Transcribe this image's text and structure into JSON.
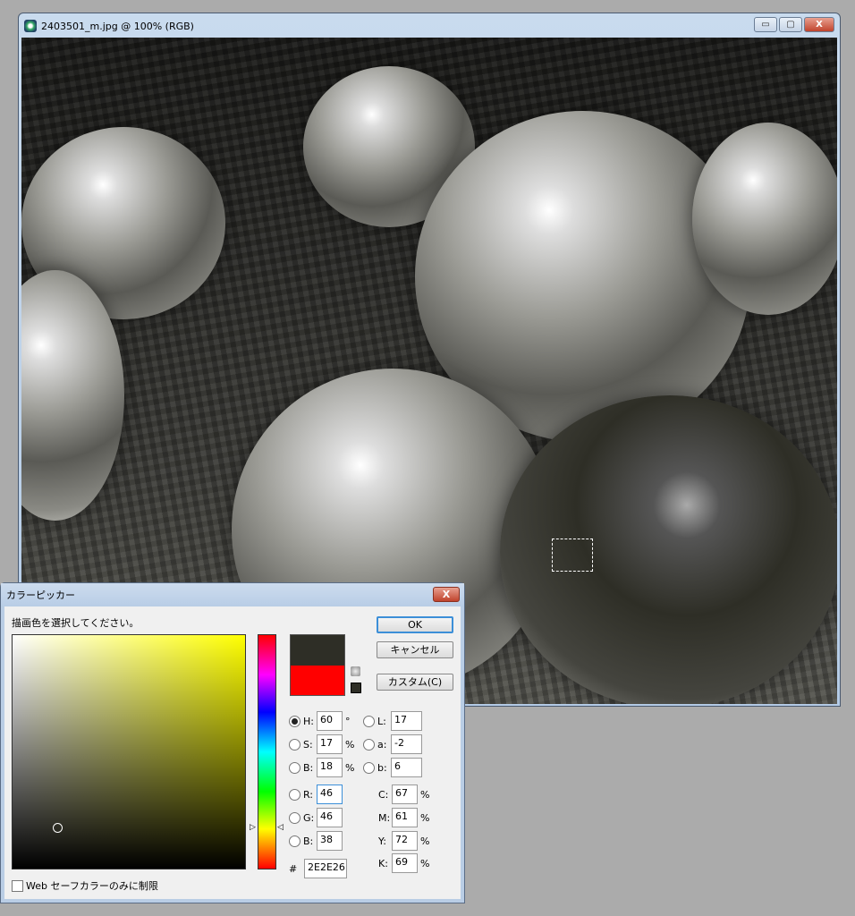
{
  "window": {
    "title": "2403501_m.jpg @ 100% (RGB)",
    "minimize": "▭",
    "maximize": "▢",
    "close": "X"
  },
  "dialog": {
    "title": "カラーピッカー",
    "close": "X",
    "prompt": "描画色を選択してください。",
    "ok": "OK",
    "cancel": "キャンセル",
    "custom": "カスタム(C)",
    "new_color": "#2e2e26",
    "current_color": "#ff0000",
    "hsb": [
      {
        "label": "H:",
        "value": "60",
        "unit": "°",
        "selected": true
      },
      {
        "label": "S:",
        "value": "17",
        "unit": "%"
      },
      {
        "label": "B:",
        "value": "18",
        "unit": "%"
      }
    ],
    "lab": [
      {
        "label": "L:",
        "value": "17"
      },
      {
        "label": "a:",
        "value": "-2"
      },
      {
        "label": "b:",
        "value": "6"
      }
    ],
    "rgb": [
      {
        "label": "R:",
        "value": "46"
      },
      {
        "label": "G:",
        "value": "46"
      },
      {
        "label": "B:",
        "value": "38"
      }
    ],
    "cmyk": [
      {
        "label": "C:",
        "value": "67",
        "unit": "%"
      },
      {
        "label": "M:",
        "value": "61",
        "unit": "%"
      },
      {
        "label": "Y:",
        "value": "72",
        "unit": "%"
      },
      {
        "label": "K:",
        "value": "69",
        "unit": "%"
      }
    ],
    "hex_label": "#",
    "hex": "2E2E26",
    "web_only": "Web セーフカラーのみに制限"
  }
}
